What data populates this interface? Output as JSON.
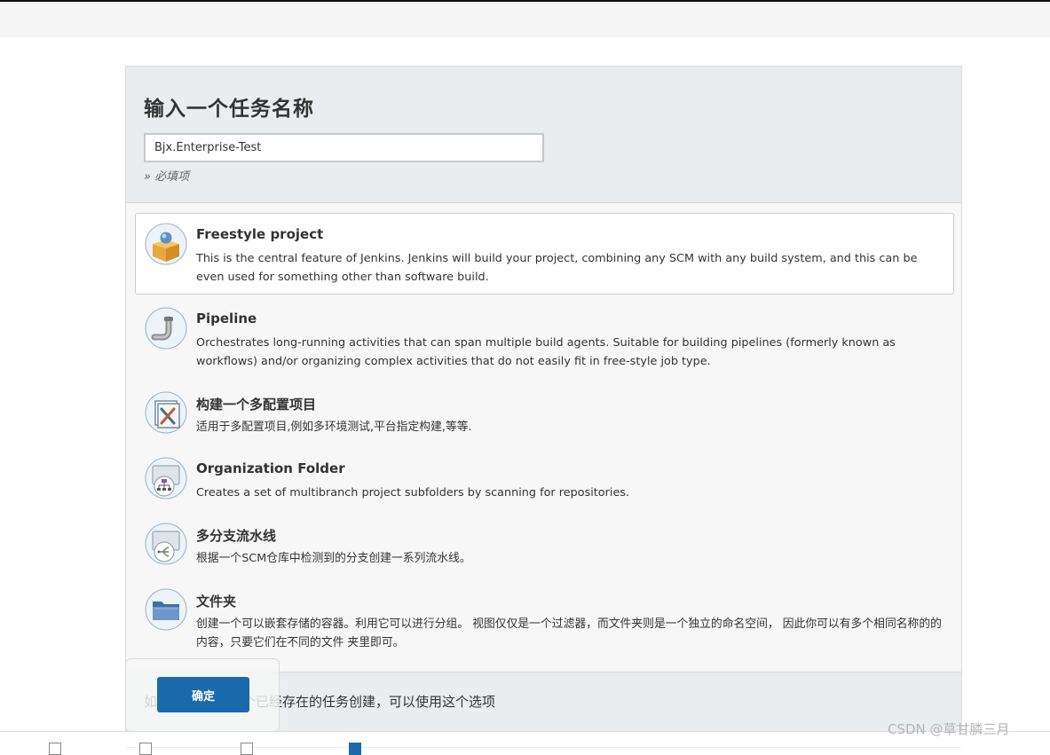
{
  "form": {
    "title": "输入一个任务名称",
    "name_value": "Bjx.Enterprise-Test",
    "required_hint": "» 必填项"
  },
  "project_types": [
    {
      "name": "Freestyle project",
      "description": "This is the central feature of Jenkins. Jenkins will build your project, combining any SCM with any build system, and this can be even used for something other than software build.",
      "icon": "freestyle-box-icon",
      "selected": true
    },
    {
      "name": "Pipeline",
      "description": "Orchestrates long-running activities that can span multiple build agents. Suitable for building pipelines (formerly known as workflows) and/or organizing complex activities that do not easily fit in free-style job type.",
      "icon": "pipeline-icon",
      "selected": false
    },
    {
      "name": "构建一个多配置项目",
      "description": "适用于多配置项目,例如多环境测试,平台指定构建,等等.",
      "icon": "multi-config-icon",
      "selected": false
    },
    {
      "name": "Organization Folder",
      "description": "Creates a set of multibranch project subfolders by scanning for repositories.",
      "icon": "organization-folder-icon",
      "selected": false
    },
    {
      "name": "多分支流水线",
      "description": "根据一个SCM仓库中检测到的分支创建一系列流水线。",
      "icon": "multibranch-icon",
      "selected": false
    },
    {
      "name": "文件夹",
      "description": "创建一个可以嵌套存储的容器。利用它可以进行分组。 视图仅仅是一个过滤器，而文件夹则是一个独立的命名空间， 因此你可以有多个相同名称的的内容，只要它们在不同的文件 夹里即可。",
      "icon": "folder-icon",
      "selected": false
    }
  ],
  "copy_section": {
    "text_start": "如",
    "text_end": "个已经存在的任务创建，可以使用这个选项"
  },
  "ok_button": {
    "label": "确定"
  },
  "watermark": "CSDN @草甘膦三月",
  "colors": {
    "primary_button": "#1a6aab",
    "panel_header": "#e9edef",
    "panel_body": "#f7f7f7"
  }
}
